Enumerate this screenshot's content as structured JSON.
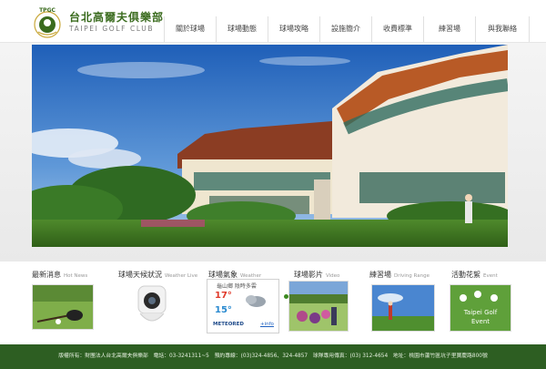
{
  "brand": {
    "name_zh": "台北高爾夫俱樂部",
    "name_en": "TAIPEI GOLF CLUB",
    "logo_text": "TPGC"
  },
  "nav": {
    "items": [
      {
        "label": "關於球場"
      },
      {
        "label": "球場動態"
      },
      {
        "label": "球場攻略"
      },
      {
        "label": "設施簡介"
      },
      {
        "label": "收費標準"
      },
      {
        "label": "練習場"
      },
      {
        "label": "與我聯絡"
      }
    ]
  },
  "slider": {
    "count": 5,
    "active_index": 4
  },
  "cards": {
    "news": {
      "zh": "最新消息",
      "en": "Hot News"
    },
    "weather_cam": {
      "zh": "球場天候狀況",
      "en": "Weather Live"
    },
    "weather": {
      "zh": "球場氣象",
      "en": "Weather",
      "widget_head": "龜山鄉 陰時多雲",
      "high": "17°",
      "low": "15°",
      "brand": "METEORED",
      "link": "+info"
    },
    "video": {
      "zh": "球場影片",
      "en": "Video"
    },
    "range": {
      "zh": "練習場",
      "en": "Driving Range"
    },
    "event": {
      "zh": "活動花絮",
      "en": "Event",
      "badge_line1": "Taipei Golf",
      "badge_line2": "Event"
    }
  },
  "footer": {
    "text": "版權所有：財團法人台北高爾夫俱樂部　電話：03-3241311~5　預約專線：(03)324-4856、324-4857　球隊專用傳真：(03) 312-4654　地址：桃園市蘆竹區坑子里寶慶路800號"
  },
  "colors": {
    "brand_green": "#3a6b1e",
    "footer_green": "#2d5e22",
    "dot_active": "#3c8a20"
  }
}
